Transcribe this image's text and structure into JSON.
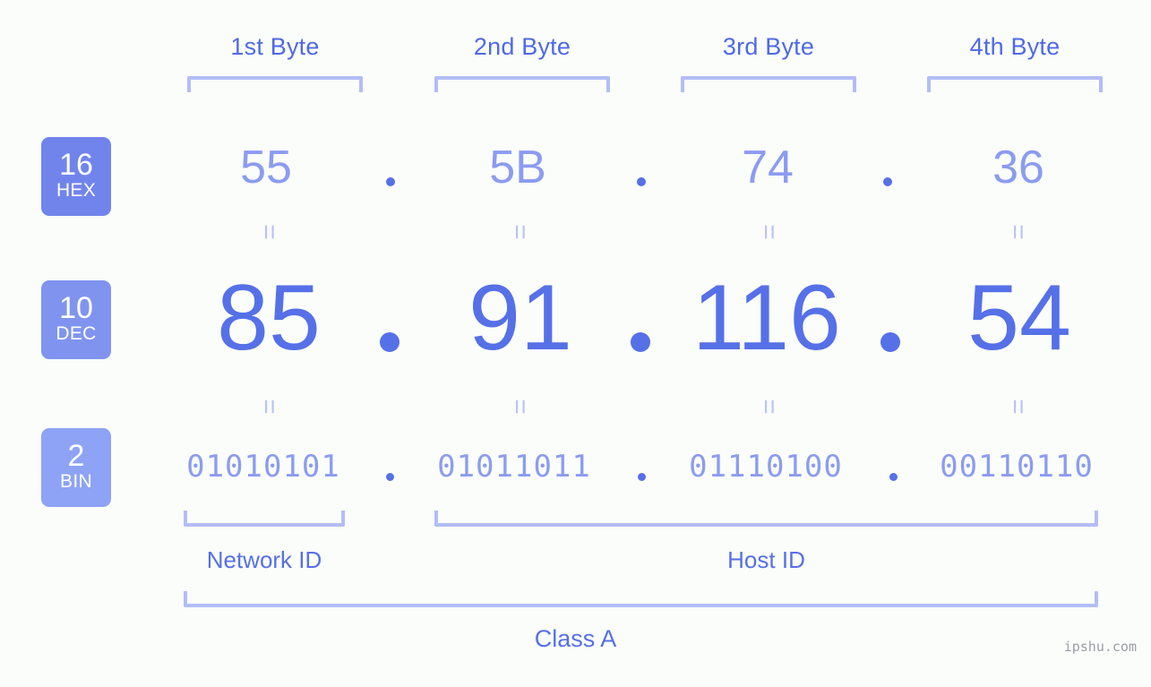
{
  "background_color": "#fbfdfa",
  "accent_color": "#5670e8",
  "accent_light_color": "#8b9cf0",
  "bracket_color": "#b3bdf7",
  "byte_headers": [
    {
      "label": "1st Byte"
    },
    {
      "label": "2nd Byte"
    },
    {
      "label": "3rd Byte"
    },
    {
      "label": "4th Byte"
    }
  ],
  "bases": [
    {
      "number": "16",
      "name": "HEX",
      "color": "#7184ec"
    },
    {
      "number": "10",
      "name": "DEC",
      "color": "#8094ef"
    },
    {
      "number": "2",
      "name": "BIN",
      "color": "#8ea3f5"
    }
  ],
  "rows": {
    "hex": {
      "values": [
        "55",
        "5B",
        "74",
        "36"
      ],
      "separator": "."
    },
    "dec": {
      "values": [
        "85",
        "91",
        "116",
        "54"
      ],
      "separator": "."
    },
    "bin": {
      "values": [
        "01010101",
        "01011011",
        "01110100",
        "00110110"
      ],
      "separator": "."
    }
  },
  "equals_sign": "=",
  "segments": {
    "network_id": "Network ID",
    "host_id": "Host ID"
  },
  "class_label": "Class A",
  "watermark": "ipshu.com"
}
